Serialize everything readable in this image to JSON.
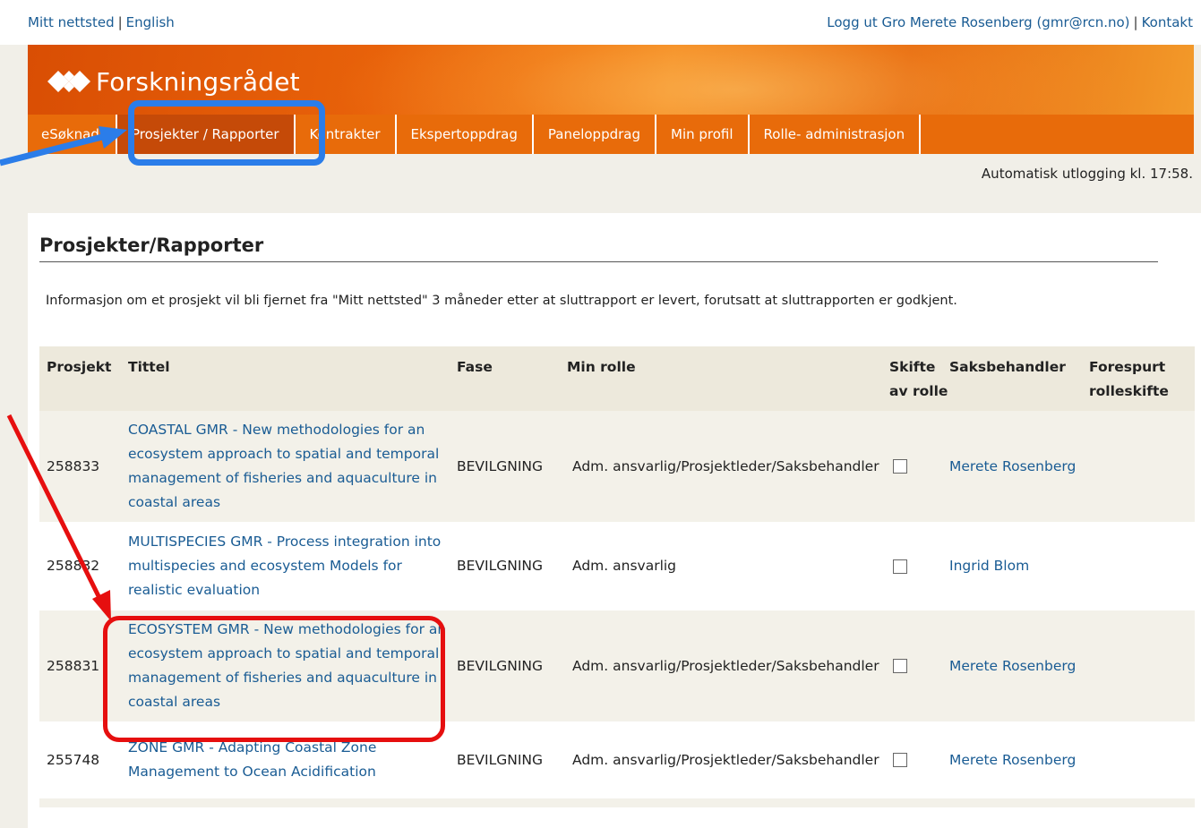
{
  "top_links": {
    "my_site": "Mitt nettsted",
    "separator": "|",
    "english": "English",
    "logout": "Logg ut Gro Merete Rosenberg (gmr@rcn.no)",
    "contact": "Kontakt"
  },
  "brand": {
    "name": "Forskningsrådet"
  },
  "nav": {
    "items": [
      {
        "label": "eSøknad"
      },
      {
        "label": "Prosjekter / Rapporter",
        "active": true
      },
      {
        "label": "Kontrakter"
      },
      {
        "label": "Ekspertoppdrag"
      },
      {
        "label": "Paneloppdrag"
      },
      {
        "label": "Min profil"
      },
      {
        "label": "Rolle- administrasjon"
      }
    ]
  },
  "session": {
    "auto_logout": "Automatisk utlogging kl. 17:58."
  },
  "page": {
    "title": "Prosjekter/Rapporter",
    "info": "Informasjon om et prosjekt vil bli fjernet fra \"Mitt nettsted\" 3 måneder etter at sluttrapport er levert, forutsatt at sluttrapporten er godkjent."
  },
  "table": {
    "headers": {
      "prosjekt": "Prosjekt",
      "tittel": "Tittel",
      "fase": "Fase",
      "min_rolle": "Min rolle",
      "skifte": "Skifte av rolle",
      "saksbehandler": "Saksbehandler",
      "forespurt": "Forespurt rolleskifte"
    },
    "rows": [
      {
        "prosjekt": "258833",
        "tittel": "COASTAL GMR - New methodologies for an ecosystem approach to spatial and temporal management of fisheries and aquaculture in coastal areas",
        "fase": "BEVILGNING",
        "min_rolle": "Adm. ansvarlig/Prosjektleder/Saksbehandler",
        "skifte_checked": false,
        "saksbehandler": "Merete Rosenberg",
        "forespurt": ""
      },
      {
        "prosjekt": "258832",
        "tittel": "MULTISPECIES GMR - Process integration into multispecies and ecosystem Models for realistic evaluation",
        "fase": "BEVILGNING",
        "min_rolle": "Adm. ansvarlig",
        "skifte_checked": false,
        "saksbehandler": "Ingrid Blom",
        "forespurt": ""
      },
      {
        "prosjekt": "258831",
        "tittel": "ECOSYSTEM GMR - New methodologies for an ecosystem approach to spatial and temporal management of fisheries and aquaculture in coastal areas",
        "fase": "BEVILGNING",
        "min_rolle": "Adm. ansvarlig/Prosjektleder/Saksbehandler",
        "skifte_checked": false,
        "saksbehandler": "Merete Rosenberg",
        "forespurt": ""
      },
      {
        "prosjekt": "255748",
        "tittel": "ZONE GMR - Adapting Coastal Zone Management to Ocean Acidification",
        "fase": "BEVILGNING",
        "min_rolle": "Adm. ansvarlig/Prosjektleder/Saksbehandler",
        "skifte_checked": false,
        "saksbehandler": "Merete Rosenberg",
        "forespurt": ""
      }
    ]
  },
  "annotations": {
    "nav_highlight_color": "#2b7de9",
    "row_highlight_color": "#e60f0f"
  }
}
